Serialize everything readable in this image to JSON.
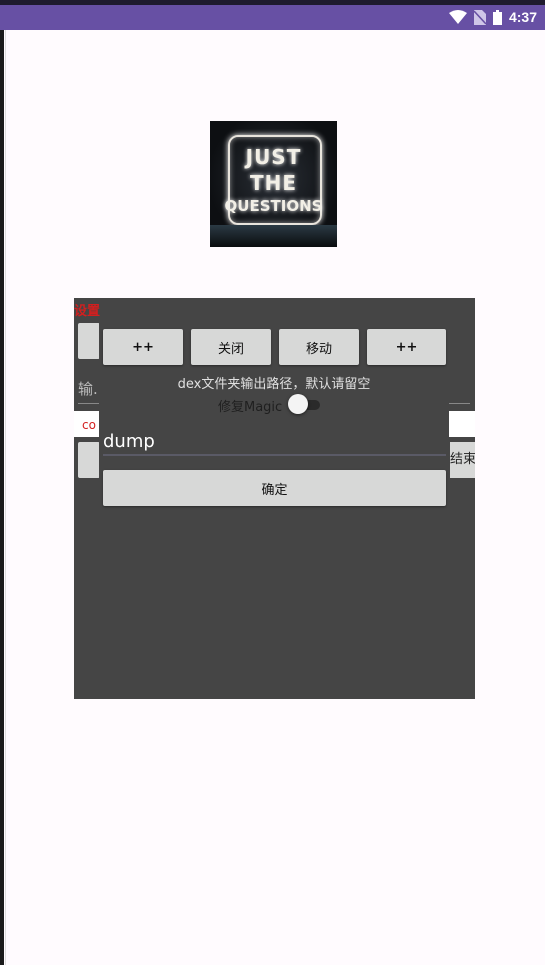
{
  "status_bar": {
    "time": "4:37",
    "icons": [
      "wifi-icon",
      "no-sim-icon",
      "battery-icon"
    ]
  },
  "logo": {
    "lines": [
      "JUST",
      "THE",
      "QUESTIONS"
    ]
  },
  "background_panel": {
    "label_partial": "设置",
    "input_partial": "输.",
    "red_text_partial": "co",
    "right_button_partial": "结束"
  },
  "dialog": {
    "buttons": [
      "++",
      "关闭",
      "移动",
      "++"
    ],
    "hint": "dex文件夹输出路径，默认请留空",
    "magic_label": "修复Magic",
    "magic_enabled": false,
    "path_value": "dump",
    "confirm_label": "确定"
  },
  "colors": {
    "status_bar": "#6750a4",
    "panel": "#454545",
    "button": "#d7d8d7",
    "warning_red": "#d21f1f"
  }
}
